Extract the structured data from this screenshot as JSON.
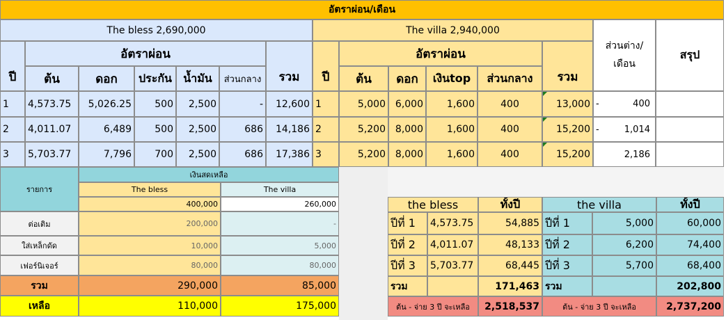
{
  "title": "อัตราผ่อน/เดือน",
  "bless": {
    "header": "The bless 2,690,000",
    "rate_label": "อัตราผ่อน",
    "col_year": "ปี",
    "col_principal": "ต้น",
    "col_interest": "ดอก",
    "col_insurance": "ประกัน",
    "col_water": "น้ำมัน",
    "col_common": "ส่วนกลาง",
    "col_total": "รวม",
    "rows": [
      {
        "year": "1",
        "principal": "4,573.75",
        "interest": "5,026.25",
        "insurance": "500",
        "water": "2,500",
        "common": "-",
        "total": "12,600"
      },
      {
        "year": "2",
        "principal": "4,011.07",
        "interest": "6,489",
        "insurance": "500",
        "water": "2,500",
        "common": "686",
        "total": "14,186"
      },
      {
        "year": "3",
        "principal": "5,703.77",
        "interest": "7,796",
        "insurance": "700",
        "water": "2,500",
        "common": "686",
        "total": "17,386"
      }
    ]
  },
  "villa": {
    "header": "The villa 2,940,000",
    "rate_label": "อัตราผ่อน",
    "col_year": "ปี",
    "col_principal": "ต้น",
    "col_interest": "ดอก",
    "col_topup": "เงินtop",
    "col_common": "ส่วนกลาง",
    "col_total": "รวม",
    "rows": [
      {
        "year": "1",
        "principal": "5,000",
        "interest": "6,000",
        "topup": "1,600",
        "common": "400",
        "total": "13,000"
      },
      {
        "year": "2",
        "principal": "5,200",
        "interest": "8,000",
        "topup": "1,600",
        "common": "400",
        "total": "15,200"
      },
      {
        "year": "3",
        "principal": "5,200",
        "interest": "8,000",
        "topup": "1,600",
        "common": "400",
        "total": "15,200"
      }
    ]
  },
  "diff": {
    "header_line1": "ส่วนต่าง/",
    "header_line2": "เดือน",
    "summary_label": "สรุป",
    "rows": [
      {
        "sign": "-",
        "value": "400"
      },
      {
        "sign": "-",
        "value": "1,014"
      },
      {
        "sign": "",
        "value": "2,186"
      }
    ]
  },
  "cash": {
    "header": "เงินสดเหลือ",
    "item_label": "รายการ",
    "bless_label": "The bless",
    "villa_label": "The villa",
    "bless_start": "400,000",
    "villa_start": "260,000",
    "rows": [
      {
        "label": "ต่อเติม",
        "bless": "200,000",
        "villa": "-"
      },
      {
        "label": "ใส่เหล็กดัด",
        "bless": "10,000",
        "villa": "5,000"
      },
      {
        "label": "เฟอร์นิเจอร์",
        "bless": "80,000",
        "villa": "80,000"
      }
    ],
    "total_label": "รวม",
    "bless_total": "290,000",
    "villa_total": "85,000",
    "remain_label": "เหลือ",
    "bless_remain": "110,000",
    "villa_remain": "175,000"
  },
  "yearly": {
    "bless_label": "the bless",
    "villa_label": "the villa",
    "all_year": "ทั้งปี",
    "rows": [
      {
        "label": "ปีที่ 1",
        "bless_month": "4,573.75",
        "bless_year": "54,885",
        "villa_label": "ปีที่ 1",
        "villa_month": "5,000",
        "villa_year": "60,000"
      },
      {
        "label": "ปีที่ 2",
        "bless_month": "4,011.07",
        "bless_year": "48,133",
        "villa_label": "ปีที่ 2",
        "villa_month": "6,200",
        "villa_year": "74,400"
      },
      {
        "label": "ปีที่ 3",
        "bless_month": "5,703.77",
        "bless_year": "68,445",
        "villa_label": "ปีที่ 3",
        "villa_month": "5,700",
        "villa_year": "68,400"
      }
    ],
    "total_label": "รวม",
    "bless_total": "171,463",
    "villa_total": "202,800",
    "remain_label": "ต้น - จ่าย 3 ปี จะเหลือ",
    "bless_remain": "2,518,537",
    "villa_remain": "2,737,200"
  },
  "colors": {
    "title_bg": "#ffc000",
    "bless_bg": "#dae8fc",
    "villa_bg": "#ffe599",
    "cash_header_bg": "#92d5dc",
    "total_orange": "#f4a460",
    "remain_yellow": "#ffff00",
    "villa_light": "#dcf0f2",
    "remain_red": "#f28b82"
  }
}
